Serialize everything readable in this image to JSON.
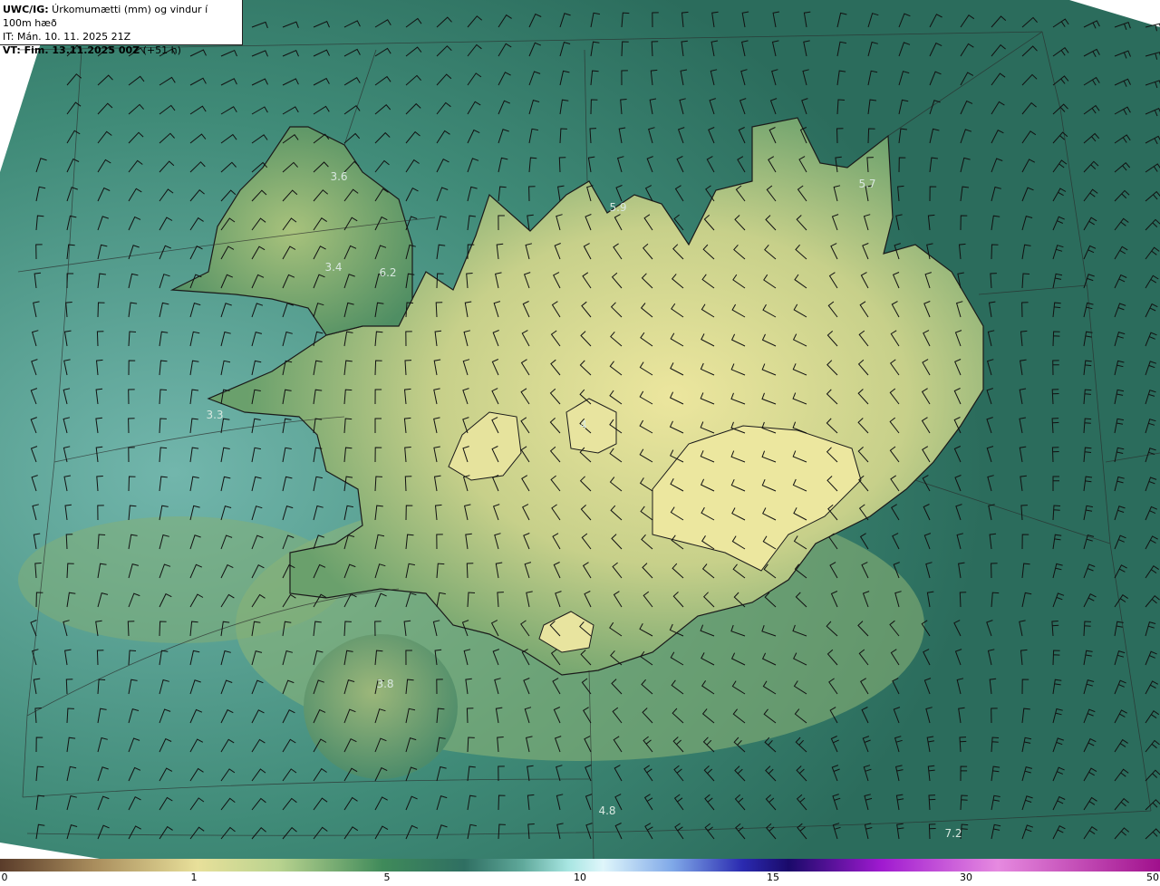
{
  "header": {
    "title_bold": "UWC/IG:",
    "title_rest": " Úrkomumætti (mm) og vindur í 100m hæð",
    "initial_time": "IT: Mán. 10. 11. 2025 21Z",
    "valid_time_bold": "VT: Fim. 13.11.2025 00Z",
    "valid_time_rest": " (+51 h)"
  },
  "value_labels": [
    {
      "text": "3.6"
    },
    {
      "text": "3.4"
    },
    {
      "text": "6.2"
    },
    {
      "text": "3.3"
    },
    {
      "text": "5.9"
    },
    {
      "text": "5.7"
    },
    {
      "text": "4"
    },
    {
      "text": "3.8"
    },
    {
      "text": "4.8"
    },
    {
      "text": "7.2"
    }
  ],
  "colorbar": {
    "ticks": [
      "0",
      "1",
      "5",
      "10",
      "15",
      "30",
      "50"
    ],
    "colors": [
      "#5a3c2a",
      "#a88c5c",
      "#e8e09a",
      "#b9d38f",
      "#3f8a5a",
      "#2f6f62",
      "#5fa89a",
      "#a8e6e2",
      "#dff6fb",
      "#7fa8e8",
      "#2a2ab0",
      "#1a0a6a",
      "#a01ad0",
      "#e68ae0",
      "#a0108c"
    ]
  },
  "map": {
    "ocean_color": "#2f6f62",
    "land_low_color": "#5b9a66",
    "land_high_color": "#e5e49c"
  }
}
